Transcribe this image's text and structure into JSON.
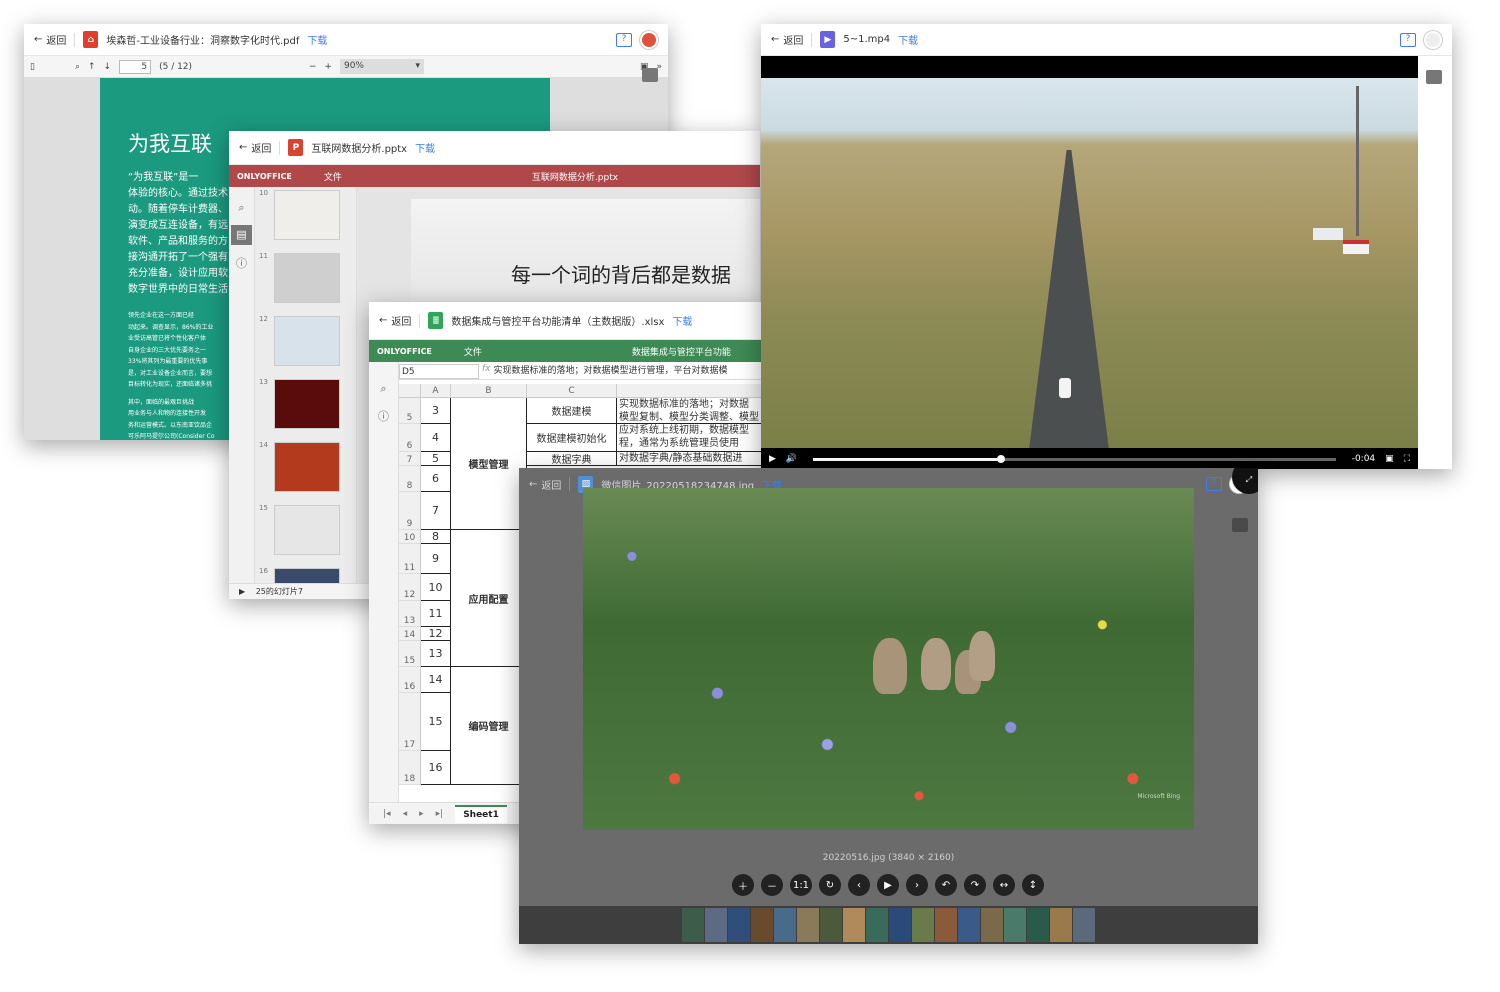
{
  "common": {
    "back_label": "返回",
    "download_label": "下载"
  },
  "pdf": {
    "file_name": "埃森哲-工业设备行业：洞察数字化时代.pdf",
    "page_current": "5",
    "page_total": "(5 / 12)",
    "zoom": "90%",
    "heading": "为我互联",
    "paragraphs": [
      "“为我互联”是一",
      "体验的核心。通过技术",
      "动。随着停车计费器、",
      "演变成互连设备，有远",
      "软件、产品和服务的方",
      "接沟通开拓了一个强有",
      "充分准备，设计应用软",
      "数字世界中的日常生活"
    ],
    "small_text": [
      "领先企业在这一方面已经",
      "动起来。调查显示，86%的工业",
      "业受访高管已将个性化客户体",
      "自身企业的三大优先要务之一",
      "33%将其列为最重要的优先事",
      "是，对工业设备企业而言，要想",
      "目标转化为现实，还面临诸多挑"
    ],
    "small_text2": [
      "其中，面临的最艰巨挑战",
      "用业务与人和物的连接性开发",
      "务和运营模式。以东南亚饮品企",
      "可乐阿马提尔公司(Consider Co"
    ],
    "accent": "#1b9a7f"
  },
  "pptx": {
    "file_name": "互联网数据分析.pptx",
    "editor_brand": "ONLYOFFICE",
    "file_menu": "文件",
    "doc_title": "互联网数据分析.pptx",
    "slide_numbers": [
      "10",
      "11",
      "12",
      "13",
      "14",
      "15",
      "16"
    ],
    "slide_text": "每一个词的背后都是数据",
    "status": "25的幻灯片7",
    "accent": "#b0484a"
  },
  "xlsx": {
    "file_name": "数据集成与管控平台功能清单（主数据版）.xlsx",
    "editor_brand": "ONLYOFFICE",
    "file_menu": "文件",
    "doc_title": "数据集成与管控平台功能",
    "cell_ref": "D5",
    "fx": "fx",
    "formula": "实现数据标准的落地；对数据模型进行管理，平台对数据模",
    "columns": [
      "A",
      "B",
      "C"
    ],
    "rows": [
      {
        "row": "5",
        "a": "3",
        "h": 26
      },
      {
        "row": "6",
        "a": "4",
        "h": 28
      },
      {
        "row": "7",
        "a": "5",
        "h": 14
      },
      {
        "row": "8",
        "a": "6",
        "h": 26
      },
      {
        "row": "9",
        "a": "7",
        "h": 38
      },
      {
        "row": "10",
        "a": "8",
        "h": 14
      },
      {
        "row": "11",
        "a": "9",
        "h": 30
      },
      {
        "row": "12",
        "a": "10",
        "h": 27
      },
      {
        "row": "13",
        "a": "11",
        "h": 26
      },
      {
        "row": "14",
        "a": "12",
        "h": 14
      },
      {
        "row": "15",
        "a": "13",
        "h": 26
      },
      {
        "row": "16",
        "a": "14",
        "h": 26
      },
      {
        "row": "17",
        "a": "15",
        "h": 58
      },
      {
        "row": "18",
        "a": "16",
        "h": 34
      }
    ],
    "groups": [
      "模型管理",
      "应用配置",
      "编码管理"
    ],
    "c_values": [
      "数据建模",
      "数据建模初始化",
      "数据字典"
    ],
    "d_values": [
      "实现数据标准的落地；对数据",
      "模型复制、模型分类调整、模型",
      "应对系统上线初期，数据模型",
      "程，通常为系统管理员使用",
      "对数据字典/静态基础数据进"
    ],
    "sheet_tab": "Sheet1",
    "accent": "#3e8a54"
  },
  "video": {
    "file_name": "5~1.mp4",
    "time": "-0:04",
    "progress": 0.36
  },
  "image": {
    "file_name": "微信图片_20220518234748.jpg",
    "caption": "20220516.jpg (3840 × 2160)",
    "watermark": "Microsoft Bing",
    "controls": [
      "＋",
      "－",
      "1:1",
      "↻",
      "‹",
      "▶",
      "›",
      "↶",
      "↷",
      "↔",
      "↕"
    ]
  }
}
